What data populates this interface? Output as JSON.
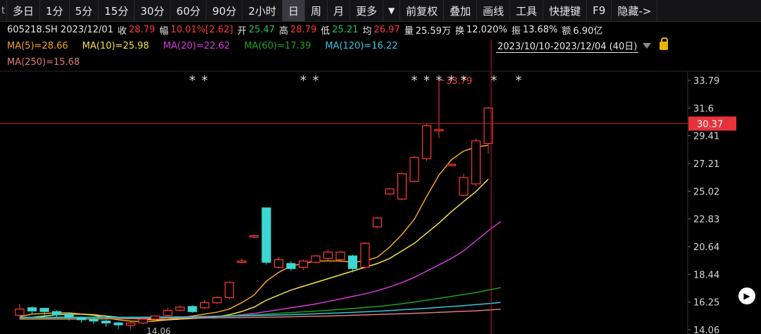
{
  "toolbar": {
    "left_edge": "t",
    "items": [
      "多日",
      "1分",
      "5分",
      "15分",
      "30分",
      "60分",
      "90分",
      "2小时",
      "日",
      "周",
      "月",
      "更多"
    ],
    "active": "日",
    "dropdown_icon": "triangle-down-icon",
    "items2": [
      "前复权",
      "叠加",
      "画线",
      "工具",
      "快捷键",
      "F9",
      "隐藏->"
    ]
  },
  "quote": {
    "code_date": "605218.SH 2023/12/01",
    "close_label": "收",
    "close": "28.79",
    "chg_label": "幅",
    "chg": "10.01%[2.62]",
    "open_label": "开",
    "open": "25.47",
    "high_label": "高",
    "high": "28.79",
    "low_label": "低",
    "low": "25.21",
    "avg_label": "均",
    "avg": "26.97",
    "vol_label": "量",
    "vol": "25.59万",
    "turn_label": "换",
    "turn": "12.020%",
    "amp_label": "振",
    "amp": "13.68%",
    "amt_label": "额",
    "amt": "6.90亿"
  },
  "ma": {
    "ma5": "MA(5)=28.66",
    "ma10": "MA(10)=25.98",
    "ma20": "MA(20)=22.62",
    "ma60": "MA(60)=17.39",
    "ma120": "MA(120)=16.22",
    "ma250": "MA(250)=15.68"
  },
  "range": {
    "text": "2023/10/10-2023/12/04 (40日)",
    "dropdown_icon": "triangle-down-icon",
    "lock_icon": "lock-icon"
  },
  "colors": {
    "up": "#ff3a3a",
    "down": "#3dd6d0",
    "ma5": "#f5a623",
    "ma10": "#f2e14a",
    "ma20": "#d43bd9",
    "ma60": "#1fa31f",
    "ma120": "#36c6e0",
    "ma250": "#e07a7a",
    "crosshair": "#c0202a",
    "price_tag_bg": "#e8323a"
  },
  "chart_data": {
    "type": "candlestick",
    "y_ticks": [
      33.79,
      31.6,
      29.41,
      27.21,
      25.02,
      22.83,
      20.64,
      18.44,
      16.25,
      14.06
    ],
    "ylim": [
      14.06,
      33.79
    ],
    "crosshair_price": "30.37",
    "high_annotation": "33.79",
    "low_annotation": "14.06",
    "markers": [
      "*",
      "*",
      "*",
      "*",
      "*",
      "*",
      "*",
      "*",
      "*",
      "*",
      "*"
    ],
    "candles": [
      {
        "o": 15.2,
        "c": 15.7,
        "h": 16.1,
        "l": 14.9
      },
      {
        "o": 15.8,
        "c": 15.55,
        "h": 15.9,
        "l": 15.3
      },
      {
        "o": 15.75,
        "c": 15.5,
        "h": 15.8,
        "l": 15.2
      },
      {
        "o": 15.5,
        "c": 15.25,
        "h": 15.6,
        "l": 15.0
      },
      {
        "o": 15.3,
        "c": 15.05,
        "h": 15.4,
        "l": 14.8
      },
      {
        "o": 15.0,
        "c": 14.85,
        "h": 15.1,
        "l": 14.6
      },
      {
        "o": 14.9,
        "c": 14.75,
        "h": 15.0,
        "l": 14.5
      },
      {
        "o": 14.75,
        "c": 14.6,
        "h": 14.85,
        "l": 14.3
      },
      {
        "o": 14.6,
        "c": 14.45,
        "h": 14.7,
        "l": 14.1
      },
      {
        "o": 14.4,
        "c": 14.6,
        "h": 14.7,
        "l": 14.06
      },
      {
        "o": 14.6,
        "c": 14.9,
        "h": 15.0,
        "l": 14.5
      },
      {
        "o": 14.9,
        "c": 15.15,
        "h": 15.2,
        "l": 14.8
      },
      {
        "o": 15.2,
        "c": 15.6,
        "h": 15.8,
        "l": 15.0
      },
      {
        "o": 15.6,
        "c": 15.85,
        "h": 16.0,
        "l": 15.5
      },
      {
        "o": 15.9,
        "c": 15.5,
        "h": 16.0,
        "l": 15.4
      },
      {
        "o": 15.8,
        "c": 16.2,
        "h": 16.4,
        "l": 15.7
      },
      {
        "o": 16.2,
        "c": 16.6,
        "h": 16.7,
        "l": 16.1
      },
      {
        "o": 16.6,
        "c": 17.8,
        "h": 17.9,
        "l": 16.5
      },
      {
        "o": 19.4,
        "c": 19.5,
        "h": 19.7,
        "l": 19.3
      },
      {
        "o": 21.4,
        "c": 21.5,
        "h": 21.6,
        "l": 21.3
      },
      {
        "o": 23.7,
        "c": 19.4,
        "h": 23.7,
        "l": 19.2
      },
      {
        "o": 19.0,
        "c": 19.6,
        "h": 19.8,
        "l": 18.9
      },
      {
        "o": 19.3,
        "c": 18.9,
        "h": 19.5,
        "l": 18.7
      },
      {
        "o": 19.0,
        "c": 19.5,
        "h": 19.6,
        "l": 18.8
      },
      {
        "o": 19.4,
        "c": 19.9,
        "h": 20.0,
        "l": 19.3
      },
      {
        "o": 19.7,
        "c": 20.2,
        "h": 20.4,
        "l": 19.5
      },
      {
        "o": 19.6,
        "c": 20.2,
        "h": 20.3,
        "l": 19.4
      },
      {
        "o": 19.9,
        "c": 18.9,
        "h": 20.0,
        "l": 18.6
      },
      {
        "o": 19.0,
        "c": 20.9,
        "h": 21.0,
        "l": 18.9
      },
      {
        "o": 22.2,
        "c": 22.9,
        "h": 23.0,
        "l": 22.1
      },
      {
        "o": 24.8,
        "c": 25.2,
        "h": 25.3,
        "l": 24.7
      },
      {
        "o": 24.4,
        "c": 26.4,
        "h": 26.5,
        "l": 24.3
      },
      {
        "o": 25.8,
        "c": 27.7,
        "h": 27.8,
        "l": 25.7
      },
      {
        "o": 27.6,
        "c": 30.2,
        "h": 30.4,
        "l": 27.4
      },
      {
        "o": 29.8,
        "c": 29.9,
        "h": 33.79,
        "l": 29.2
      },
      {
        "o": 27.1,
        "c": 27.15,
        "h": 27.2,
        "l": 27.0
      },
      {
        "o": 24.7,
        "c": 26.1,
        "h": 26.4,
        "l": 24.6
      },
      {
        "o": 25.6,
        "c": 29.0,
        "h": 29.2,
        "l": 25.4
      },
      {
        "o": 28.8,
        "c": 31.6,
        "h": 31.7,
        "l": 28.0
      }
    ],
    "series": [
      {
        "name": "MA(5)",
        "values": [
          15.1,
          15.3,
          15.35,
          15.4,
          15.4,
          15.3,
          15.2,
          15.0,
          14.85,
          14.75,
          14.7,
          14.75,
          14.85,
          15.0,
          15.15,
          15.3,
          15.45,
          15.7,
          16.2,
          16.8,
          17.9,
          18.6,
          19.1,
          19.3,
          19.5,
          19.5,
          19.5,
          19.4,
          19.5,
          19.8,
          20.6,
          21.6,
          22.8,
          24.6,
          26.3,
          27.5,
          28.2,
          28.5,
          28.66
        ]
      },
      {
        "name": "MA(10)",
        "values": [
          15.0,
          15.05,
          15.15,
          15.25,
          15.3,
          15.3,
          15.25,
          15.15,
          15.05,
          14.95,
          14.9,
          14.85,
          14.85,
          14.9,
          14.95,
          15.0,
          15.1,
          15.25,
          15.5,
          15.85,
          16.4,
          16.8,
          17.2,
          17.5,
          17.8,
          18.1,
          18.4,
          18.7,
          19.0,
          19.3,
          19.7,
          20.3,
          20.9,
          21.7,
          22.5,
          23.4,
          24.2,
          25.0,
          25.98
        ]
      },
      {
        "name": "MA(20)",
        "values": [
          14.9,
          14.92,
          14.95,
          14.98,
          15.0,
          15.02,
          15.03,
          15.03,
          15.03,
          15.02,
          15.0,
          15.0,
          15.0,
          15.01,
          15.03,
          15.06,
          15.1,
          15.15,
          15.25,
          15.35,
          15.5,
          15.65,
          15.8,
          15.95,
          16.1,
          16.3,
          16.5,
          16.7,
          16.9,
          17.15,
          17.45,
          17.8,
          18.2,
          18.7,
          19.2,
          19.7,
          20.3,
          21.1,
          21.9,
          22.62
        ]
      },
      {
        "name": "MA(60)",
        "values": [
          14.95,
          14.96,
          14.97,
          14.98,
          14.99,
          15.0,
          15.0,
          15.01,
          15.01,
          15.02,
          15.03,
          15.04,
          15.05,
          15.07,
          15.09,
          15.11,
          15.14,
          15.17,
          15.2,
          15.24,
          15.3,
          15.36,
          15.42,
          15.48,
          15.54,
          15.6,
          15.67,
          15.74,
          15.82,
          15.9,
          16.0,
          16.12,
          16.25,
          16.4,
          16.55,
          16.7,
          16.85,
          17.0,
          17.2,
          17.39
        ]
      },
      {
        "name": "MA(120)",
        "values": [
          15.05,
          15.05,
          15.05,
          15.05,
          15.05,
          15.05,
          15.05,
          15.05,
          15.05,
          15.05,
          15.05,
          15.06,
          15.07,
          15.08,
          15.09,
          15.1,
          15.12,
          15.14,
          15.16,
          15.18,
          15.2,
          15.23,
          15.26,
          15.29,
          15.32,
          15.36,
          15.4,
          15.44,
          15.48,
          15.53,
          15.58,
          15.64,
          15.7,
          15.76,
          15.83,
          15.9,
          15.97,
          16.05,
          16.13,
          16.22
        ]
      },
      {
        "name": "MA(250)",
        "values": [
          14.9,
          14.9,
          14.9,
          14.9,
          14.9,
          14.9,
          14.91,
          14.92,
          14.93,
          14.94,
          14.95,
          14.96,
          14.97,
          14.98,
          14.99,
          15.0,
          15.01,
          15.02,
          15.03,
          15.04,
          15.05,
          15.07,
          15.09,
          15.11,
          15.13,
          15.15,
          15.18,
          15.21,
          15.24,
          15.27,
          15.3,
          15.33,
          15.36,
          15.4,
          15.44,
          15.48,
          15.52,
          15.56,
          15.62,
          15.68
        ]
      }
    ]
  }
}
